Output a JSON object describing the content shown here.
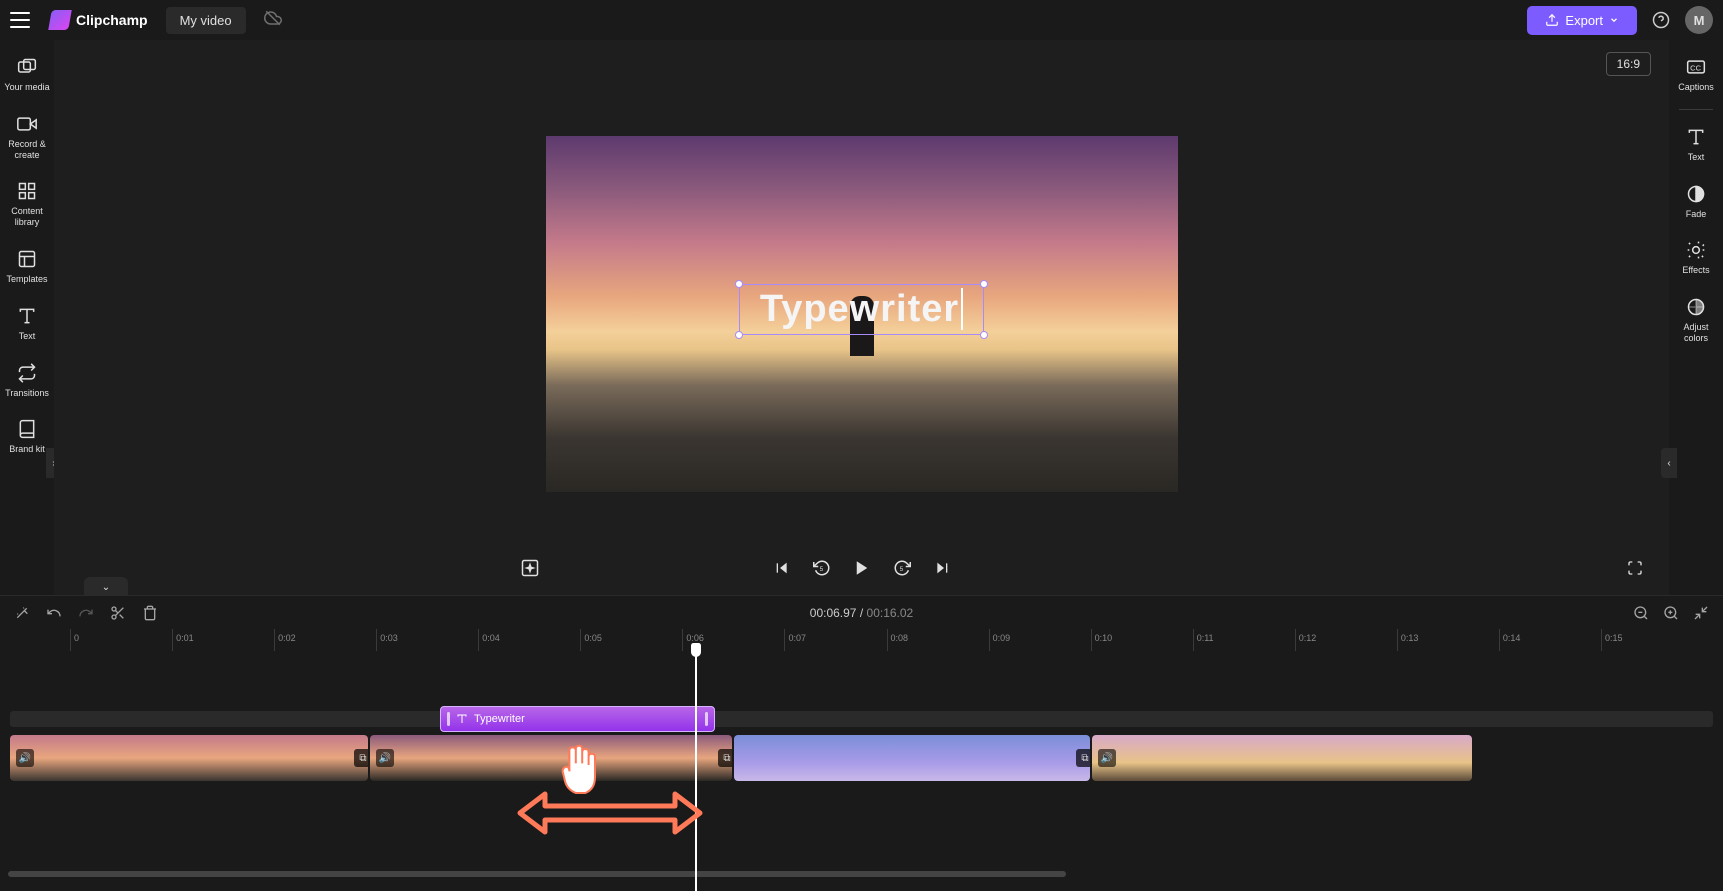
{
  "header": {
    "brand": "Clipchamp",
    "project_name": "My video",
    "export_label": "Export",
    "avatar_initial": "M"
  },
  "left_sidebar": {
    "your_media": "Your media",
    "record_create": "Record & create",
    "content_library": "Content library",
    "templates": "Templates",
    "text": "Text",
    "transitions": "Transitions",
    "brand_kit": "Brand kit"
  },
  "right_sidebar": {
    "captions": "Captions",
    "text": "Text",
    "fade": "Fade",
    "effects": "Effects",
    "adjust_colors": "Adjust colors"
  },
  "preview": {
    "aspect_ratio": "16:9",
    "overlay_text": "Typewriter"
  },
  "timeline": {
    "current_time": "00:06.97",
    "separator": "/",
    "duration": "00:16.02",
    "ruler": [
      "0",
      "0:01",
      "0:02",
      "0:03",
      "0:04",
      "0:05",
      "0:06",
      "0:07",
      "0:08",
      "0:09",
      "0:10",
      "0:11",
      "0:12",
      "0:13",
      "0:14",
      "0:15"
    ],
    "text_clip_label": "Typewriter"
  }
}
